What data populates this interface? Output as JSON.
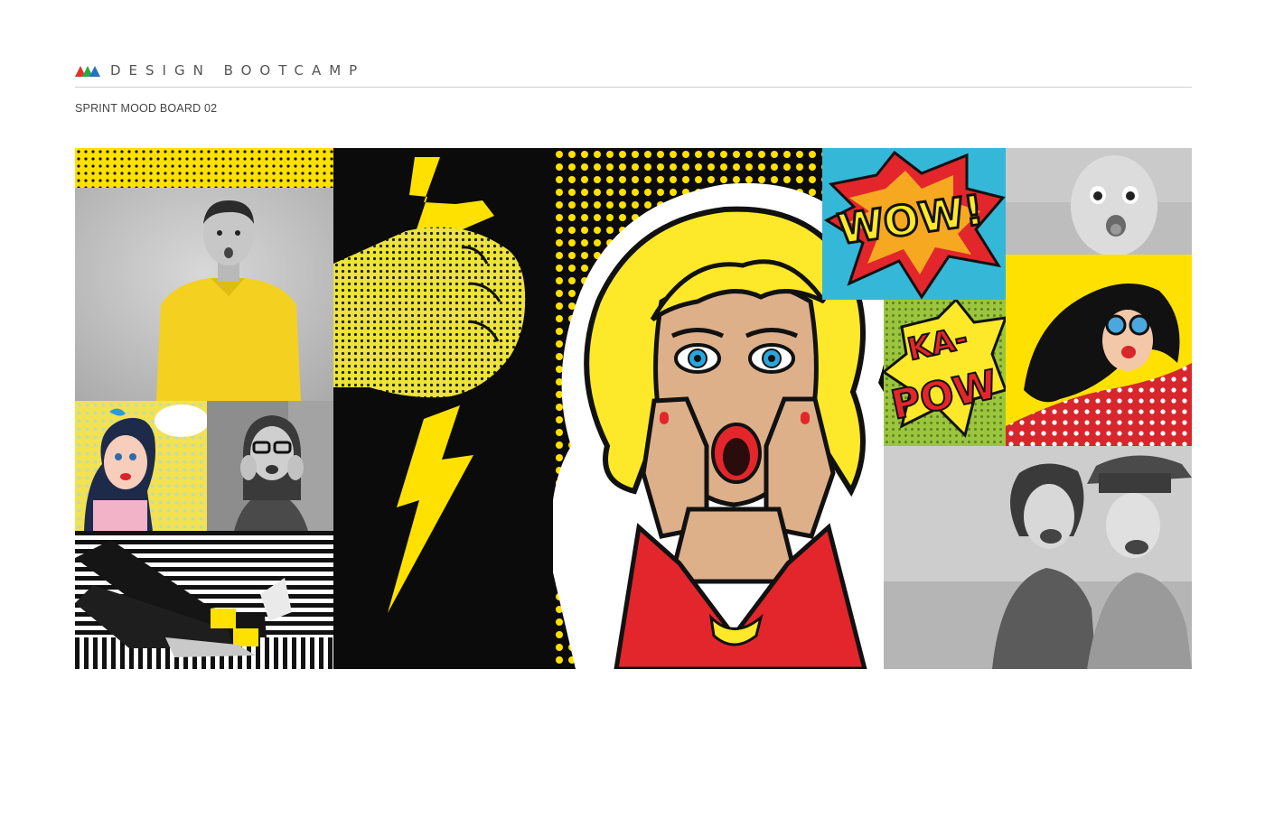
{
  "header": {
    "brand": "DESIGN BOOTCAMP",
    "subtitle": "SPRINT MOOD BOARD 02"
  },
  "board": {
    "wow_text": "WOW!",
    "kapow_top": "KA-",
    "kapow_bottom": "POW"
  },
  "colors": {
    "yellow": "#ffe100",
    "black": "#0b0b0b",
    "red": "#e3262b",
    "cyan": "#35b7d8",
    "skin": "#ddb08a",
    "logo_red": "#e4312b",
    "logo_green": "#2aa84a",
    "logo_blue": "#2470c4"
  }
}
